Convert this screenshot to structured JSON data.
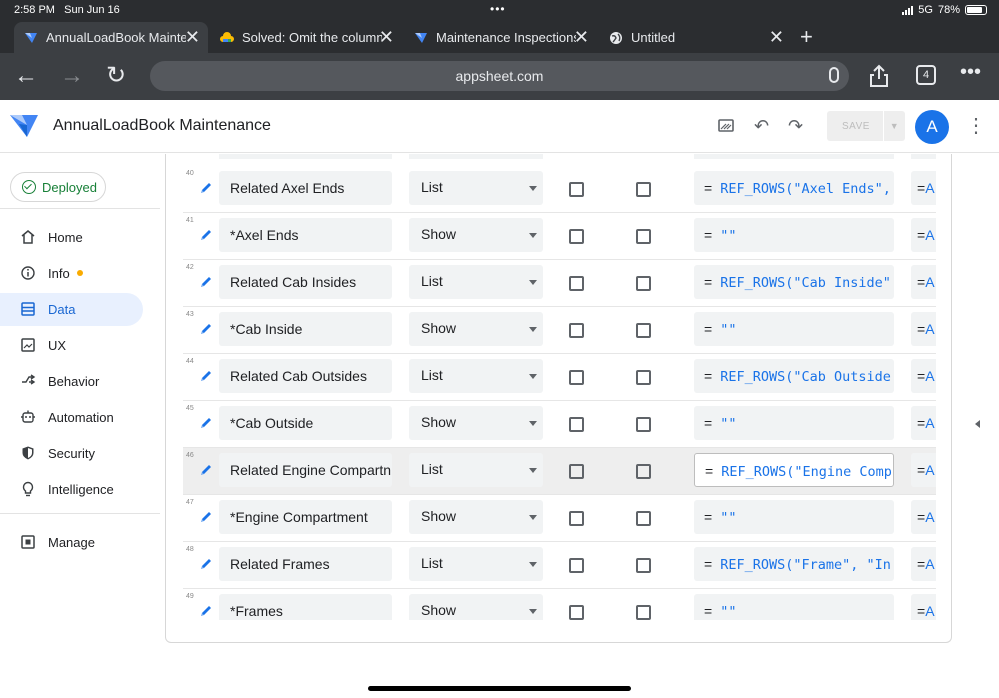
{
  "status": {
    "time": "2:58 PM",
    "date": "Sun Jun 16",
    "network": "5G",
    "battery": "78%"
  },
  "tabs": [
    {
      "title": "AnnualLoadBook Mainten",
      "icon": "appsheet-icon"
    },
    {
      "title": "Solved: Omit the column",
      "icon": "google-cloud-icon"
    },
    {
      "title": "Maintenance Inspections",
      "icon": "appsheet-icon"
    },
    {
      "title": "Untitled",
      "icon": "globe-icon"
    }
  ],
  "browser": {
    "url": "appsheet.com",
    "tab_count": "4"
  },
  "app": {
    "title": "AnnualLoadBook Maintenance",
    "save_label": "SAVE",
    "avatar_letter": "A"
  },
  "sidebar": {
    "status": "Deployed",
    "items": [
      {
        "label": "Home",
        "icon": "home-icon"
      },
      {
        "label": "Info",
        "icon": "info-icon"
      },
      {
        "label": "Data",
        "icon": "data-icon"
      },
      {
        "label": "UX",
        "icon": "ux-icon"
      },
      {
        "label": "Behavior",
        "icon": "behavior-icon"
      },
      {
        "label": "Automation",
        "icon": "automation-icon"
      },
      {
        "label": "Security",
        "icon": "security-icon"
      },
      {
        "label": "Intelligence",
        "icon": "intelligence-icon"
      },
      {
        "label": "Manage",
        "icon": "manage-icon"
      }
    ]
  },
  "rows": [
    {
      "num": "40",
      "name": "Related Axel Ends",
      "type": "List",
      "formula": "REF_ROWS(\"Axel Ends\",",
      "app": "=A"
    },
    {
      "num": "41",
      "name": "*Axel Ends",
      "type": "Show",
      "formula": "\"\"",
      "app": "=A"
    },
    {
      "num": "42",
      "name": "Related Cab Insides",
      "type": "List",
      "formula": "REF_ROWS(\"Cab Inside\"",
      "app": "=A"
    },
    {
      "num": "43",
      "name": "*Cab Inside",
      "type": "Show",
      "formula": "\"\"",
      "app": "=A"
    },
    {
      "num": "44",
      "name": "Related Cab Outsides",
      "type": "List",
      "formula": "REF_ROWS(\"Cab Outside",
      "app": "=A"
    },
    {
      "num": "45",
      "name": "*Cab Outside",
      "type": "Show",
      "formula": "\"\"",
      "app": "=A"
    },
    {
      "num": "46",
      "name": "Related Engine Compartn",
      "type": "List",
      "formula": "REF_ROWS(\"Engine Comp",
      "app": "=A"
    },
    {
      "num": "47",
      "name": "*Engine Compartment",
      "type": "Show",
      "formula": "\"\"",
      "app": "=A"
    },
    {
      "num": "48",
      "name": "Related Frames",
      "type": "List",
      "formula": "REF_ROWS(\"Frame\", \"In",
      "app": "=A"
    },
    {
      "num": "49",
      "name": "*Frames",
      "type": "Show",
      "formula": "\"\"",
      "app": "=A"
    }
  ],
  "colors": {
    "accent": "#1a73e8",
    "deployed": "#188038",
    "active_nav_bg": "#e8f0fe",
    "info_dot": "#f9ab00"
  }
}
